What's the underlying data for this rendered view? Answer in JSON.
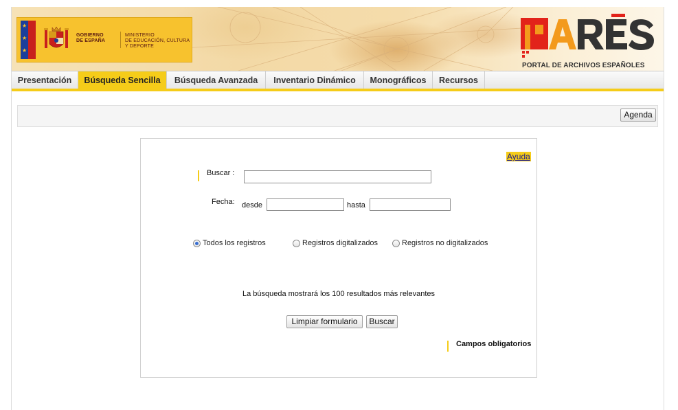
{
  "header": {
    "gov_line1": "GOBIERNO",
    "gov_line2": "DE ESPAÑA",
    "ministry_line1": "MINISTERIO",
    "ministry_line2": "DE EDUCACIÓN, CULTURA",
    "ministry_line3": "Y DEPORTE",
    "logo_word": "PARES",
    "logo_tagline": "PORTAL DE ARCHIVOS ESPAÑOLES"
  },
  "nav": {
    "tabs": [
      {
        "label": "Presentación",
        "active": false
      },
      {
        "label": "Búsqueda Sencilla",
        "active": true
      },
      {
        "label": "Búsqueda Avanzada",
        "active": false
      },
      {
        "label": "Inventario Dinámico",
        "active": false
      },
      {
        "label": "Monográficos",
        "active": false
      },
      {
        "label": "Recursos",
        "active": false
      }
    ]
  },
  "toolbar": {
    "agenda_label": "Agenda"
  },
  "form": {
    "help_label": "Ayuda",
    "search_label": "Buscar :",
    "search_value": "",
    "date_label": "Fecha:",
    "from_label": "desde",
    "from_value": "",
    "to_label": "hasta",
    "to_value": "",
    "radios": [
      {
        "label": "Todos los registros",
        "checked": true
      },
      {
        "label": "Registros digitalizados",
        "checked": false
      },
      {
        "label": "Registros no digitalizados",
        "checked": false
      }
    ],
    "notice": "La búsqueda mostrará los 100 resultados más relevantes",
    "clear_label": "Limpiar formulario",
    "submit_label": "Buscar",
    "required_note": "Campos obligatorios"
  },
  "colors": {
    "accent_yellow": "#f5cc19",
    "flag_red": "#c8201d",
    "logo_red": "#e2231a",
    "logo_orange": "#f39a1c"
  }
}
